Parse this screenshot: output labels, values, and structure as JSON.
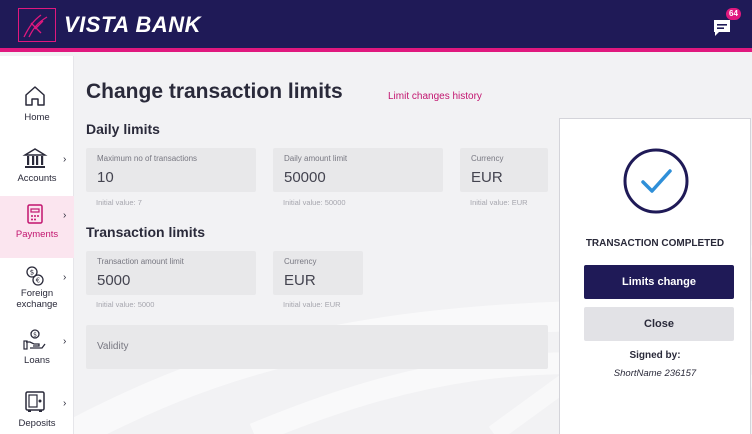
{
  "header": {
    "brand": "VISTA BANK",
    "notification_count": "64"
  },
  "sidebar": {
    "items": [
      {
        "label": "Home",
        "icon": "home-icon"
      },
      {
        "label": "Accounts",
        "icon": "bank-icon"
      },
      {
        "label": "Payments",
        "icon": "payments-icon",
        "active": true
      },
      {
        "label": "Foreign exchange",
        "label_line1": "Foreign",
        "label_line2": "exchange",
        "icon": "currency-exchange-icon"
      },
      {
        "label": "Loans",
        "icon": "loans-icon"
      },
      {
        "label": "Deposits",
        "icon": "deposits-icon"
      }
    ]
  },
  "main": {
    "title": "Change transaction limits",
    "history_link": "Limit changes history",
    "daily": {
      "title": "Daily limits",
      "fields": [
        {
          "label": "Maximum no of transactions",
          "value": "10",
          "initial": "Initial value: 7"
        },
        {
          "label": "Daily amount limit",
          "value": "50000",
          "initial": "Initial value: 50000"
        },
        {
          "label": "Currency",
          "value": "EUR",
          "initial": "Initial value: EUR"
        }
      ]
    },
    "transaction": {
      "title": "Transaction limits",
      "fields": [
        {
          "label": "Transaction amount limit",
          "value": "5000",
          "initial": "Initial value: 5000"
        },
        {
          "label": "Currency",
          "value": "EUR",
          "initial": "Initial value: EUR"
        }
      ]
    },
    "validity_label": "Validity"
  },
  "result": {
    "status": "TRANSACTION COMPLETED",
    "primary_button": "Limits change",
    "secondary_button": "Close",
    "signed_by_label": "Signed by:",
    "signer": "ShortName 236157"
  },
  "colors": {
    "primary": "#1f1a57",
    "accent": "#e0187e",
    "check": "#2f8fd8"
  }
}
